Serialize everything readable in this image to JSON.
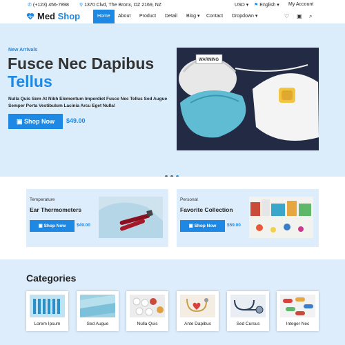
{
  "topbar": {
    "phone": "(+123) 456-7898",
    "address": "1370 Clvd, The Bronx, OZ 2169, NZ",
    "currency": "USD",
    "language": "English",
    "account": "My Account"
  },
  "brand": {
    "name_a": "Med",
    "name_b": "Shop"
  },
  "nav": [
    "Home",
    "About",
    "Product",
    "Detail",
    "Blog",
    "Contact",
    "Dropdown"
  ],
  "hero": {
    "eyebrow": "New Arrivals",
    "title_line1": "Fusce Nec Dapibus",
    "title_line2": "Tellus",
    "description": "Nulla Quis Sem At Nibh Elementum Imperdiet Fusce Nec Tellus Sed Augue Semper Porta Vestibulum Lacinia Arcu Eget Nulla!",
    "button": "Shop Now",
    "price": "$49.00",
    "slides": 3,
    "active_slide": 3,
    "mask_text": "WARNING"
  },
  "promos": [
    {
      "tag": "Temperature",
      "title": "Ear Thermometers",
      "button": "Shop Now",
      "price": "$49.00"
    },
    {
      "tag": "Personal",
      "title": "Favorite Collection",
      "button": "Shop Now",
      "price": "$59.00"
    }
  ],
  "categories": {
    "heading": "Categories",
    "items": [
      "Lorem Ipsum",
      "Sed Augue",
      "Nulla Quis",
      "Ante Dapibus",
      "Sed Cursus",
      "Integer Nec"
    ]
  },
  "icons": {
    "phone": "phone-icon",
    "location": "map-pin-icon",
    "flag": "flag-icon",
    "wishlist": "heart-icon",
    "cart": "cart-icon",
    "search": "search-icon"
  },
  "colors": {
    "accent": "#1e88e5",
    "hero_bg": "#dbecfb",
    "section_bg": "#deedfb"
  }
}
